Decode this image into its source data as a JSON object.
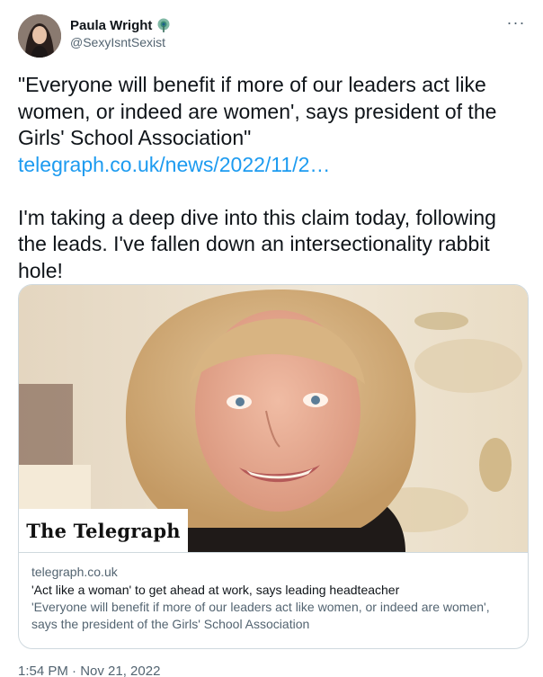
{
  "author": {
    "name": "Paula Wright",
    "handle": "@SexyIsntSexist",
    "avatar_icon": "avatar",
    "badge_icon": "peacock-badge-icon"
  },
  "menu": {
    "more_label": "···"
  },
  "tweet": {
    "paragraph1": "\"Everyone will benefit if more of our leaders act like women, or indeed are women', says president of the Girls' School Association\"",
    "link_text": "telegraph.co.uk/news/2022/11/2…",
    "paragraph2": "I'm taking a deep dive into this claim today, following the leads. I've fallen down an intersectionality rabbit hole!"
  },
  "card": {
    "masthead": "The Telegraph",
    "domain": "telegraph.co.uk",
    "title": "'Act like a woman' to get ahead at work, says leading headteacher",
    "description": "'Everyone will benefit if more of our leaders act like women, or indeed are women', says the president of the Girls' School Association"
  },
  "timestamp": "1:54 PM · Nov 21, 2022",
  "colors": {
    "link": "#1d9bf0",
    "text": "#0f1419",
    "secondary": "#536471",
    "border": "#cfd9de"
  }
}
